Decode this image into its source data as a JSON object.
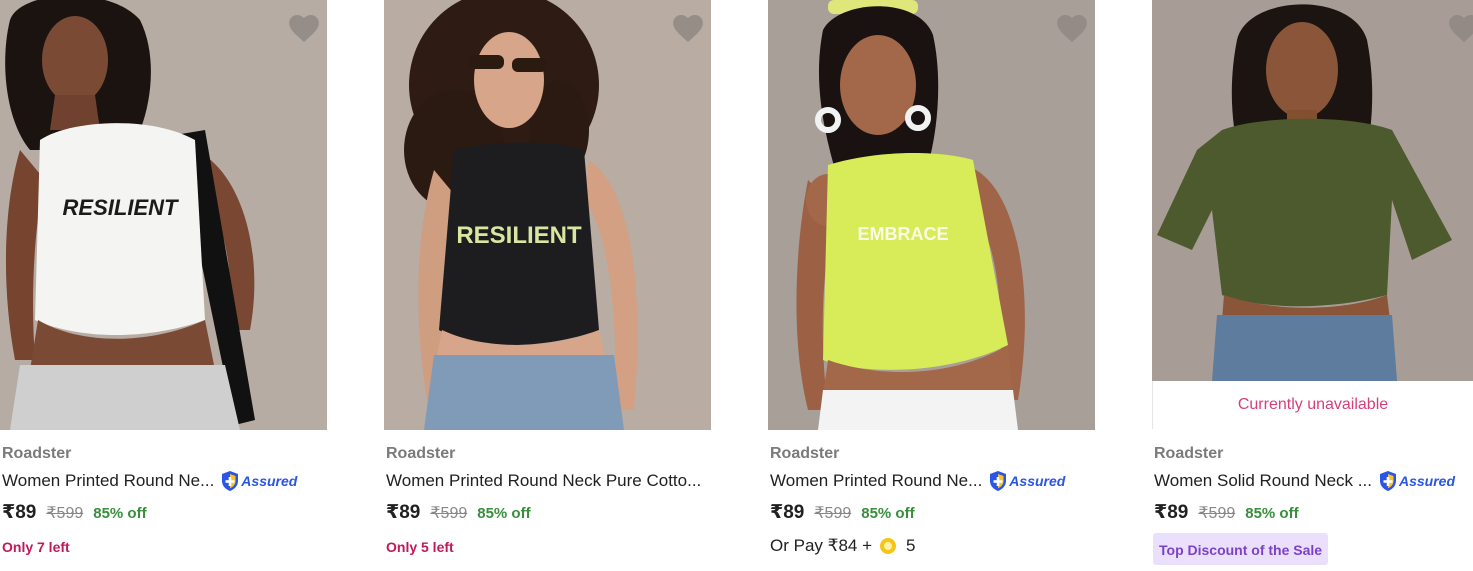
{
  "products": [
    {
      "brand": "Roadster",
      "title": "Women Printed Round Ne...",
      "assured": "Assured",
      "price": "₹89",
      "mrp": "₹599",
      "discount": "85% off",
      "stock_note": "Only 7 left",
      "print_text": "RESILIENT",
      "colors": {
        "background": "#b7aca4",
        "garment": "#f4f4f2",
        "print": "#1b1b1b"
      }
    },
    {
      "brand": "Roadster",
      "title": "Women Printed Round Neck Pure Cotto...",
      "price": "₹89",
      "mrp": "₹599",
      "discount": "85% off",
      "stock_note": "Only 5 left",
      "print_text": "RESILIENT",
      "colors": {
        "background": "#b8aca3",
        "garment": "#1d1d20",
        "print": "#d9e6a0"
      }
    },
    {
      "brand": "Roadster",
      "title": "Women Printed Round Ne...",
      "assured": "Assured",
      "price": "₹89",
      "mrp": "₹599",
      "discount": "85% off",
      "or_pay": "Or Pay ₹84 +",
      "coins": "5",
      "colors": {
        "background": "#a89f98",
        "garment": "#d7ec58",
        "print": "#ffffff"
      }
    },
    {
      "brand": "Roadster",
      "title": "Women Solid Round Neck ...",
      "assured": "Assured",
      "price": "₹89",
      "mrp": "₹599",
      "discount": "85% off",
      "availability": "Currently unavailable",
      "badge": "Top Discount of the Sale",
      "colors": {
        "background": "#a79d96",
        "garment": "#4c5a2e",
        "print": ""
      }
    }
  ],
  "icons": {
    "wishlist": "heart-icon",
    "assured": "shield-plus-icon",
    "coin": "supercoin-icon"
  },
  "accent": {
    "price_off": "#388e3c",
    "stock": "#c2185b",
    "assured": "#2a55e5",
    "unavailable": "#d63f7a",
    "badge_bg": "#ebe0fb",
    "badge_text": "#7b42c9"
  }
}
